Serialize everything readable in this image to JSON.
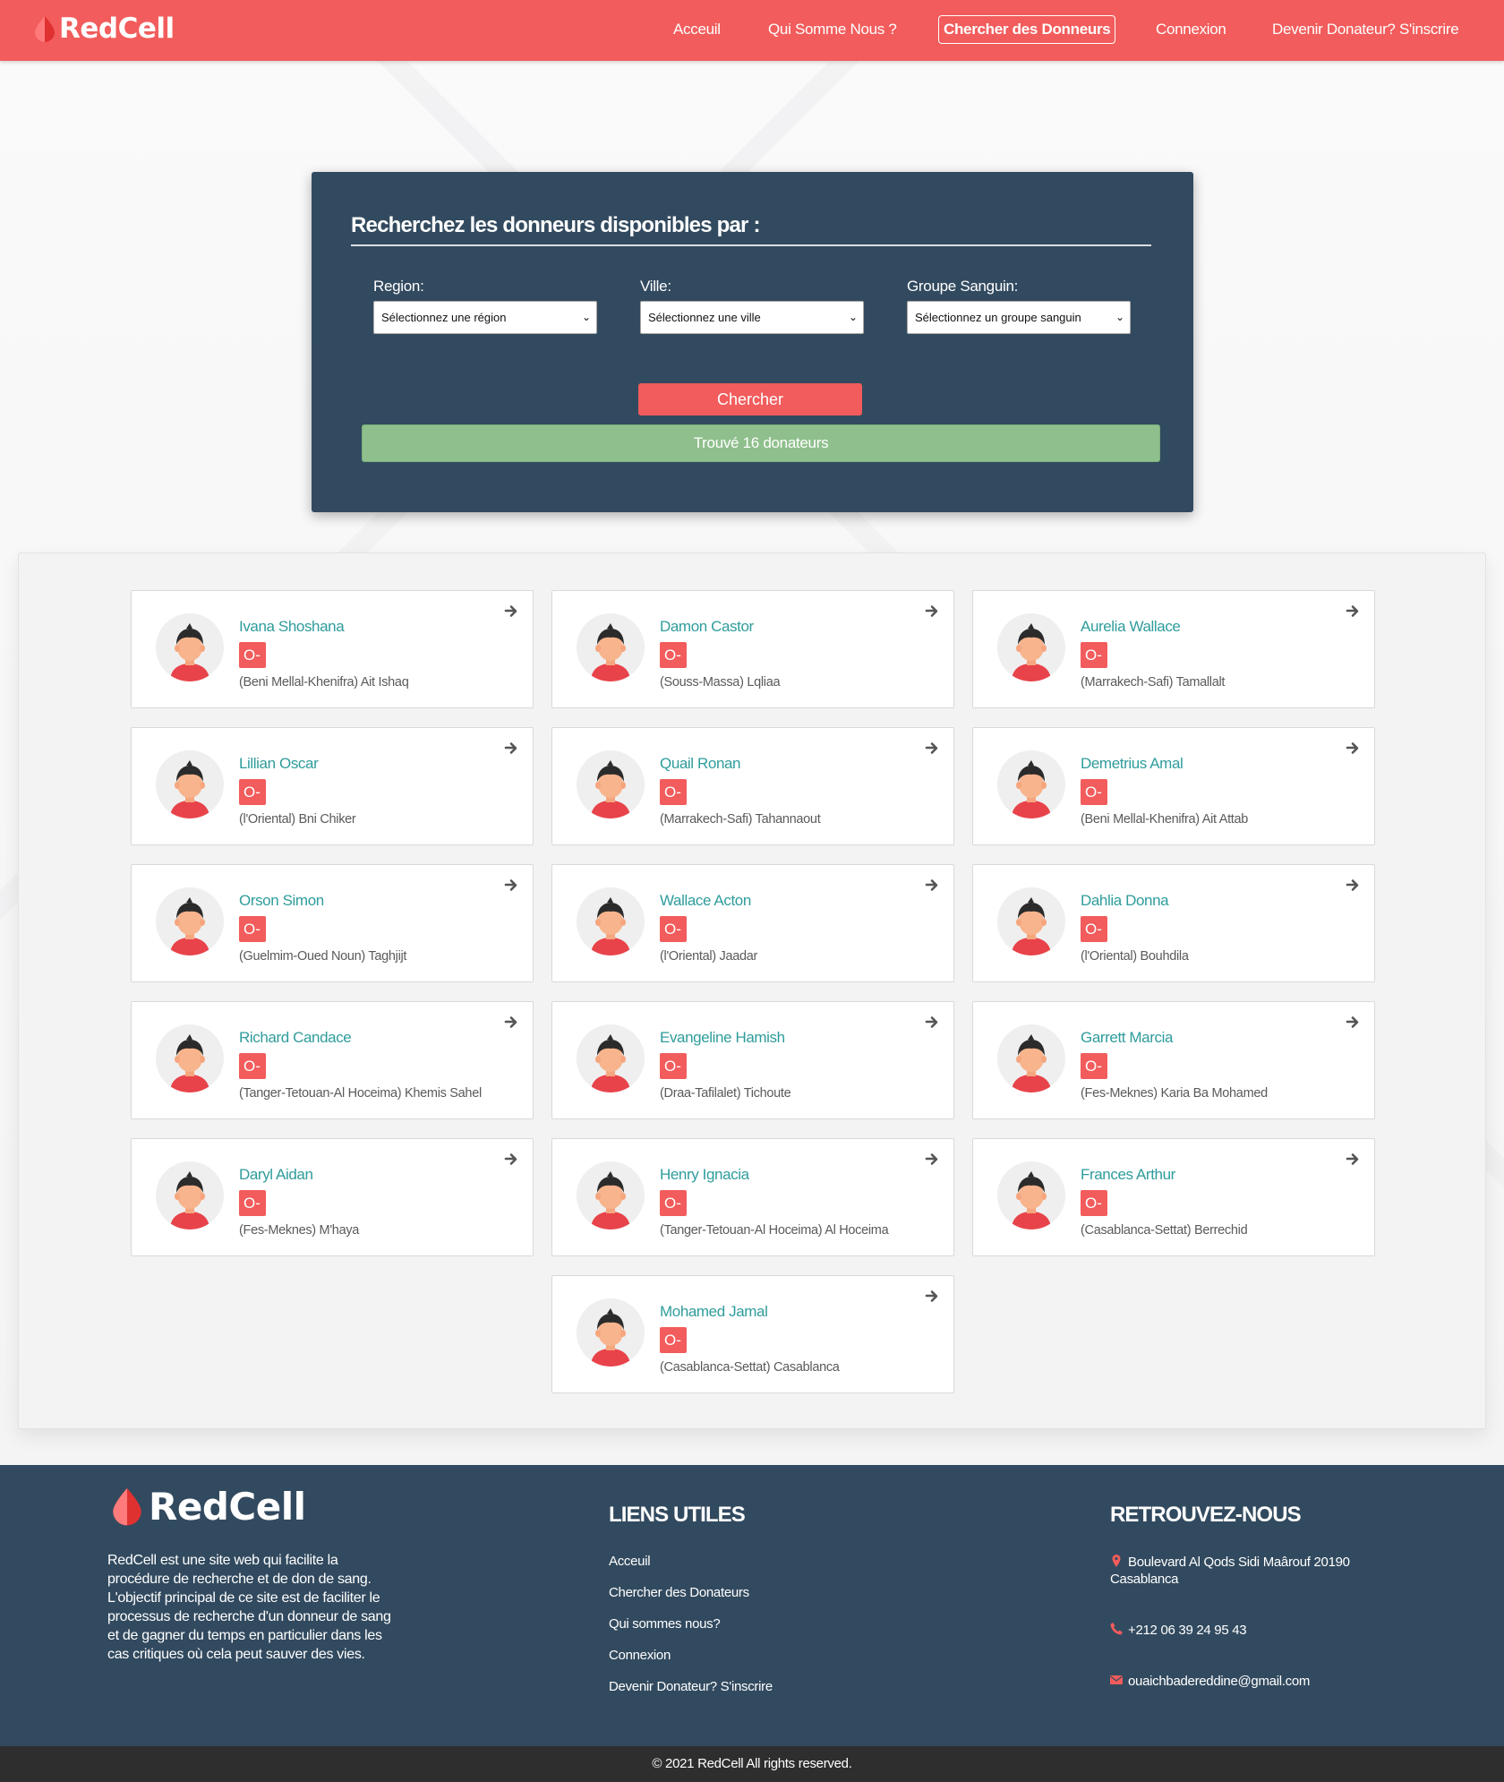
{
  "brand": {
    "name": "RedCell"
  },
  "nav": {
    "links": [
      {
        "label": "Acceuil"
      },
      {
        "label": "Qui Somme Nous ?"
      },
      {
        "label": "Chercher des Donneurs",
        "active": true
      },
      {
        "label": "Connexion"
      },
      {
        "label": "Devenir Donateur? S'inscrire"
      }
    ]
  },
  "search": {
    "title": "Recherchez les donneurs disponibles par :",
    "region": {
      "label": "Region:",
      "value": "Sélectionnez une région"
    },
    "ville": {
      "label": "Ville:",
      "value": "Sélectionnez une ville"
    },
    "groupe": {
      "label": "Groupe Sanguin:",
      "value": "Sélectionnez un groupe sanguin"
    },
    "button_label": "Chercher",
    "result_text": "Trouvé 16 donateurs"
  },
  "donors": [
    {
      "name": "Ivana Shoshana",
      "blood": "O-",
      "location": "(Beni Mellal-Khenifra) Ait Ishaq"
    },
    {
      "name": "Damon Castor",
      "blood": "O-",
      "location": "(Souss-Massa) Lqliaa"
    },
    {
      "name": "Aurelia Wallace",
      "blood": "O-",
      "location": "(Marrakech-Safi) Tamallalt"
    },
    {
      "name": "Lillian Oscar",
      "blood": "O-",
      "location": "(l'Oriental) Bni Chiker"
    },
    {
      "name": "Quail Ronan",
      "blood": "O-",
      "location": "(Marrakech-Safi) Tahannaout"
    },
    {
      "name": "Demetrius Amal",
      "blood": "O-",
      "location": "(Beni Mellal-Khenifra) Ait Attab"
    },
    {
      "name": "Orson Simon",
      "blood": "O-",
      "location": "(Guelmim-Oued Noun) Taghjijt"
    },
    {
      "name": "Wallace Acton",
      "blood": "O-",
      "location": "(l'Oriental) Jaadar"
    },
    {
      "name": "Dahlia Donna",
      "blood": "O-",
      "location": "(l'Oriental) Bouhdila"
    },
    {
      "name": "Richard Candace",
      "blood": "O-",
      "location": "(Tanger-Tetouan-Al Hoceima) Khemis Sahel"
    },
    {
      "name": "Evangeline Hamish",
      "blood": "O-",
      "location": "(Draa-Tafilalet) Tichoute"
    },
    {
      "name": "Garrett Marcia",
      "blood": "O-",
      "location": "(Fes-Meknes) Karia Ba Mohamed"
    },
    {
      "name": "Daryl Aidan",
      "blood": "O-",
      "location": "(Fes-Meknes) M'haya"
    },
    {
      "name": "Henry Ignacia",
      "blood": "O-",
      "location": "(Tanger-Tetouan-Al Hoceima) Al Hoceima"
    },
    {
      "name": "Frances Arthur",
      "blood": "O-",
      "location": "(Casablanca-Settat) Berrechid"
    },
    {
      "name": "Mohamed Jamal",
      "blood": "O-",
      "location": "(Casablanca-Settat) Casablanca"
    }
  ],
  "footer": {
    "brand": "RedCell",
    "description": "RedCell est une site web qui facilite la procédure de recherche et de don de sang. L'objectif principal de ce site est de faciliter le processus de recherche d'un donneur de sang et de gagner du temps en particulier dans les cas critiques où cela peut sauver des vies.",
    "links_heading": "LIENS UTILES",
    "links": [
      {
        "label": "Acceuil"
      },
      {
        "label": "Chercher des Donateurs"
      },
      {
        "label": "Qui sommes nous?"
      },
      {
        "label": "Connexion"
      },
      {
        "label": "Devenir Donateur? S'inscrire"
      }
    ],
    "contact_heading": "RETROUVEZ-NOUS",
    "address": "Boulevard Al Qods Sidi Maârouf 20190 Casablanca",
    "phone": "+212 06 39 24 95 43",
    "email": "ouaichbadereddine@gmail.com",
    "copyright": "© 2021 RedCell All rights reserved."
  },
  "icons": {
    "logo": "blood-drop-icon",
    "card_arrow": "arrow-right-icon",
    "avatar": "user-avatar-icon",
    "address": "map-pin-icon",
    "phone": "phone-icon",
    "email": "envelope-icon"
  },
  "colors": {
    "primary_red": "#f25c5c",
    "navy": "#324a5f",
    "teal_name": "#2f9c9c",
    "success_green": "#8fbf8c",
    "copyright_bg": "#2e2e2e"
  }
}
